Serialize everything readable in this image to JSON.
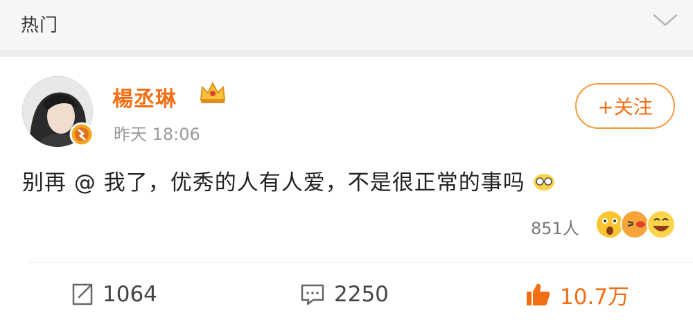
{
  "header": {
    "title": "热门"
  },
  "post": {
    "author": "楊丞琳",
    "timestamp": "昨天 18:06",
    "follow_label": "+关注",
    "text": "别再 @ 我了，优秀的人有人爱，不是很正常的事吗",
    "reaction_count": "851人"
  },
  "actions": {
    "repost_count": "1064",
    "comment_count": "2250",
    "like_count": "10.7万"
  },
  "colors": {
    "accent": "#f36e12",
    "follow_border": "#f6993c"
  }
}
